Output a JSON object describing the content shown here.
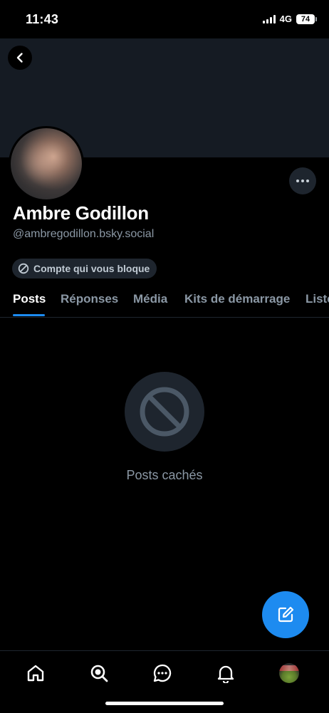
{
  "status_bar": {
    "time": "11:43",
    "network": "4G",
    "battery": "74"
  },
  "profile": {
    "display_name": "Ambre Godillon",
    "handle": "@ambregodillon.bsky.social",
    "blocked_label": "Compte qui vous bloque"
  },
  "tabs": [
    {
      "label": "Posts",
      "active": true
    },
    {
      "label": "Réponses",
      "active": false
    },
    {
      "label": "Média",
      "active": false
    },
    {
      "label": "Kits de démarrage",
      "active": false
    },
    {
      "label": "Listes",
      "active": false
    }
  ],
  "empty_state": {
    "text": "Posts cachés",
    "icon": "ban-icon"
  },
  "bottom_nav": {
    "items": [
      "home-icon",
      "search-icon",
      "chat-icon",
      "bell-icon",
      "profile-avatar"
    ]
  },
  "colors": {
    "accent": "#1d8bf0",
    "background": "#000000",
    "banner": "#151b23",
    "muted_text": "#8b98a5"
  }
}
